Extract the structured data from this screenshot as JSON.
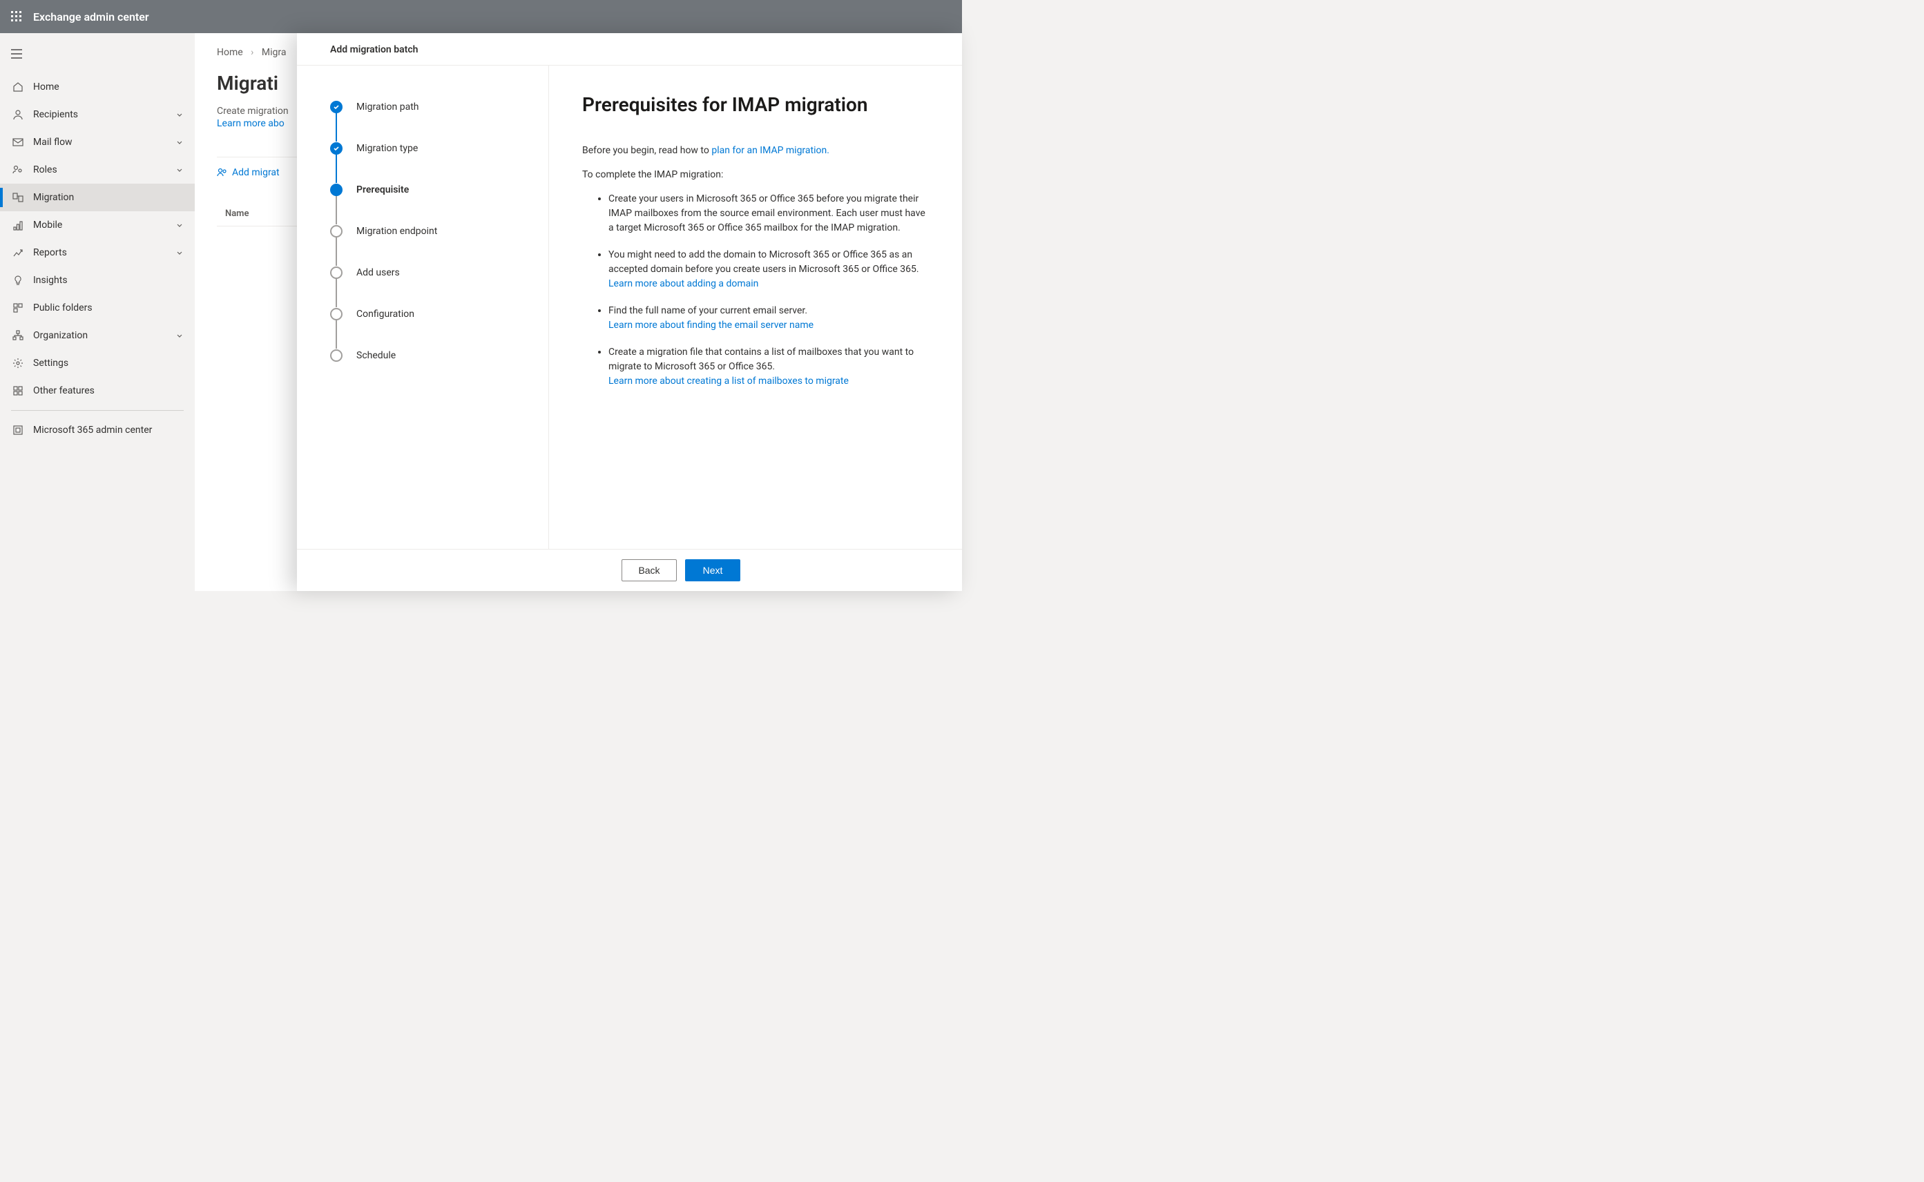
{
  "topbar": {
    "title": "Exchange admin center"
  },
  "sidebar": {
    "items": [
      {
        "label": "Home",
        "icon": "home",
        "expandable": false
      },
      {
        "label": "Recipients",
        "icon": "person",
        "expandable": true
      },
      {
        "label": "Mail flow",
        "icon": "mail",
        "expandable": true
      },
      {
        "label": "Roles",
        "icon": "roles",
        "expandable": true
      },
      {
        "label": "Migration",
        "icon": "migration",
        "expandable": false,
        "active": true
      },
      {
        "label": "Mobile",
        "icon": "mobile",
        "expandable": true
      },
      {
        "label": "Reports",
        "icon": "reports",
        "expandable": true
      },
      {
        "label": "Insights",
        "icon": "insights",
        "expandable": false
      },
      {
        "label": "Public folders",
        "icon": "folders",
        "expandable": false
      },
      {
        "label": "Organization",
        "icon": "org",
        "expandable": true
      },
      {
        "label": "Settings",
        "icon": "settings",
        "expandable": false
      },
      {
        "label": "Other features",
        "icon": "grid",
        "expandable": false
      }
    ],
    "footer_link": "Microsoft 365 admin center"
  },
  "breadcrumb": {
    "items": [
      "Home",
      "Migra"
    ]
  },
  "page": {
    "title": "Migrati",
    "desc": "Create migration",
    "learn_more": "Learn more abo",
    "add_button": "Add migrat",
    "table_header": "Name"
  },
  "panel": {
    "title": "Add migration batch",
    "steps": [
      {
        "label": "Migration path",
        "state": "done"
      },
      {
        "label": "Migration type",
        "state": "done"
      },
      {
        "label": "Prerequisite",
        "state": "current"
      },
      {
        "label": "Migration endpoint",
        "state": "todo"
      },
      {
        "label": "Add users",
        "state": "todo"
      },
      {
        "label": "Configuration",
        "state": "todo"
      },
      {
        "label": "Schedule",
        "state": "todo"
      }
    ],
    "content": {
      "heading": "Prerequisites for IMAP migration",
      "intro_before": "Before you begin, read how to ",
      "intro_link": "plan for an IMAP migration.",
      "to_complete": "To complete the IMAP migration:",
      "bullets": [
        {
          "text": "Create your users in Microsoft 365 or Office 365 before you migrate their IMAP mailboxes from the source email environment. Each user must have a target Microsoft 365 or Office 365 mailbox for the IMAP migration."
        },
        {
          "text": "You might need to add the domain to Microsoft 365 or Office 365 as an accepted domain before you create users in Microsoft 365 or Office 365.",
          "link": "Learn more about adding a domain"
        },
        {
          "text": "Find the full name of your current email server.",
          "link": "Learn more about finding the email server name"
        },
        {
          "text": "Create a migration file that contains a list of mailboxes that you want to migrate to Microsoft 365 or Office 365.",
          "link": "Learn more about creating a list of mailboxes to migrate"
        }
      ]
    },
    "buttons": {
      "back": "Back",
      "next": "Next"
    }
  }
}
